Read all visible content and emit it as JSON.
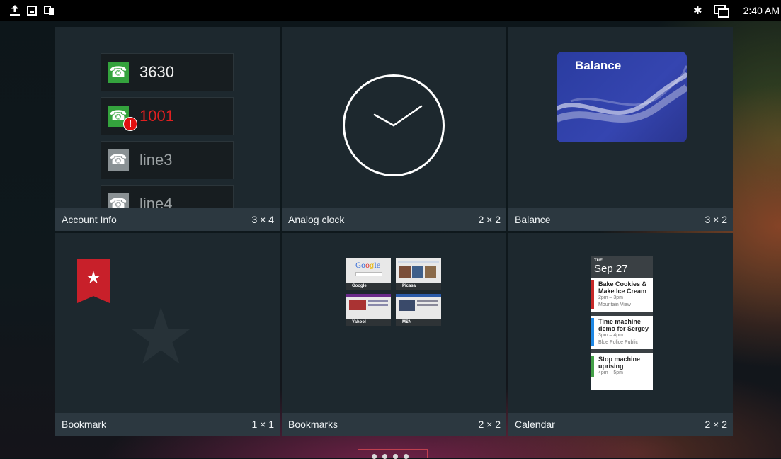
{
  "status_bar": {
    "time": "2:40 AM",
    "left_icons": [
      "upload-icon",
      "screenshot-icon",
      "usb-icon"
    ],
    "right_icons": [
      "bluetooth-icon",
      "multi-screen-icon"
    ]
  },
  "widgets": [
    {
      "name": "Account Info",
      "size": "3 × 4",
      "accounts": [
        {
          "label": "3630",
          "status": "ok",
          "color": "#34a33d"
        },
        {
          "label": "1001",
          "status": "error",
          "color": "#e02020"
        },
        {
          "label": "line3",
          "status": "inactive"
        },
        {
          "label": "line4",
          "status": "inactive"
        }
      ]
    },
    {
      "name": "Analog clock",
      "size": "2 × 2"
    },
    {
      "name": "Balance",
      "size": "3 × 2",
      "card_text": "Balance"
    },
    {
      "name": "Bookmark",
      "size": "1 × 1"
    },
    {
      "name": "Bookmarks",
      "size": "2 × 2",
      "thumbnails": [
        {
          "label": "Google"
        },
        {
          "label": "Picasa"
        },
        {
          "label": "Yahoo!"
        },
        {
          "label": "MSN"
        }
      ]
    },
    {
      "name": "Calendar",
      "size": "2 × 2",
      "day": "TUE",
      "date": "Sep 27",
      "events": [
        {
          "title1": "Bake Cookies &",
          "title2": "Make Ice Cream",
          "time": "2pm – 3pm",
          "location": "Mountain View"
        },
        {
          "title1": "Time machine",
          "title2": "demo for Sergey",
          "time": "3pm – 4pm",
          "location": "Blue Police Public"
        },
        {
          "title1": "Stop machine",
          "title2": "uprising",
          "time": "4pm – 5pm",
          "location": ""
        }
      ]
    }
  ],
  "pager": {
    "pages": 4,
    "current": 1
  }
}
